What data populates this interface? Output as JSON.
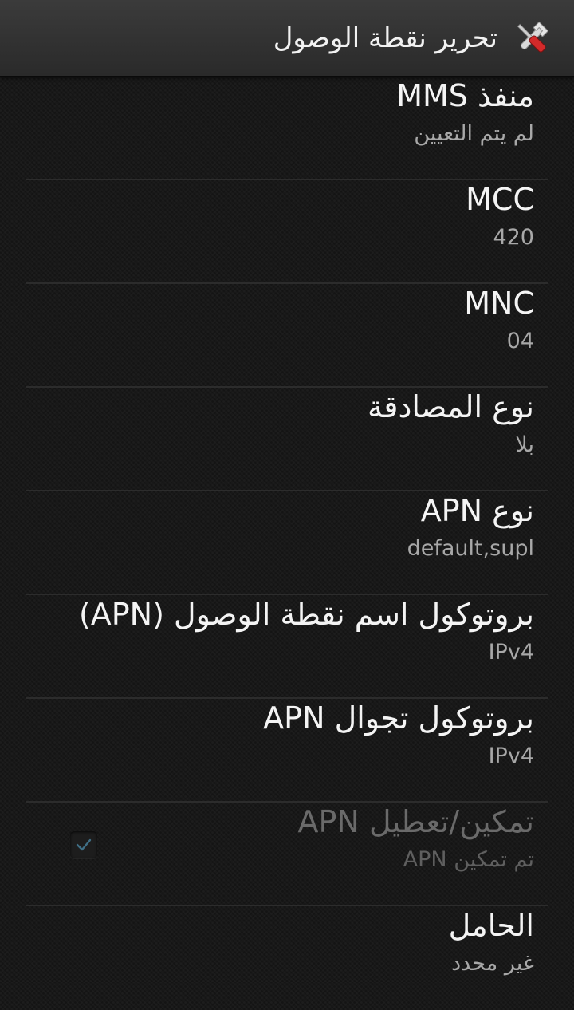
{
  "header": {
    "title": "تحرير نقطة الوصول",
    "icon": "tools-icon"
  },
  "items": [
    {
      "label": "منفذ MMS",
      "value": "لم يتم التعيين"
    },
    {
      "label": "MCC",
      "value": "420"
    },
    {
      "label": "MNC",
      "value": "04"
    },
    {
      "label": "نوع المصادقة",
      "value": "بلا"
    },
    {
      "label": "نوع APN",
      "value": "default,supl"
    },
    {
      "label": "بروتوكول اسم نقطة الوصول (APN)",
      "value": "IPv4"
    },
    {
      "label": "بروتوكول تجوال APN",
      "value": "IPv4"
    },
    {
      "label": "تمكين/تعطيل APN",
      "value": "تم تمكين APN",
      "checked": true,
      "disabled": true
    },
    {
      "label": "الحامل",
      "value": "غير محدد"
    }
  ]
}
